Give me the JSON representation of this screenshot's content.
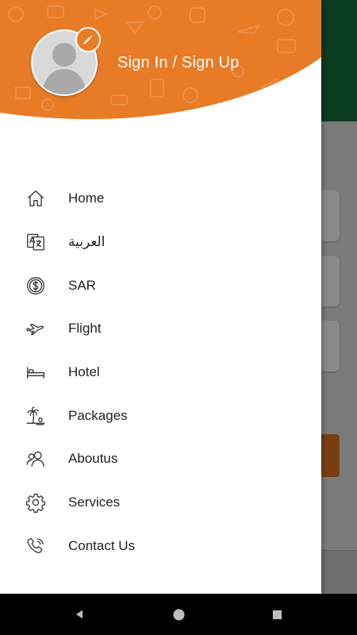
{
  "header": {
    "signin_label": "Sign In / Sign Up",
    "accent_color": "#E87B26"
  },
  "menu": {
    "items": [
      {
        "label": "Home",
        "icon": "home-icon"
      },
      {
        "label": "العربية",
        "icon": "language-icon"
      },
      {
        "label": "SAR",
        "icon": "currency-icon"
      },
      {
        "label": "Flight",
        "icon": "airplane-icon"
      },
      {
        "label": "Hotel",
        "icon": "bed-icon"
      },
      {
        "label": "Packages",
        "icon": "palm-beach-icon"
      },
      {
        "label": "Aboutus",
        "icon": "users-icon"
      },
      {
        "label": "Services",
        "icon": "gear-icon"
      },
      {
        "label": "Contact Us",
        "icon": "phone-icon"
      }
    ]
  },
  "navbar": {
    "back": "back-icon",
    "home": "home-circle-icon",
    "recents": "recents-icon"
  }
}
